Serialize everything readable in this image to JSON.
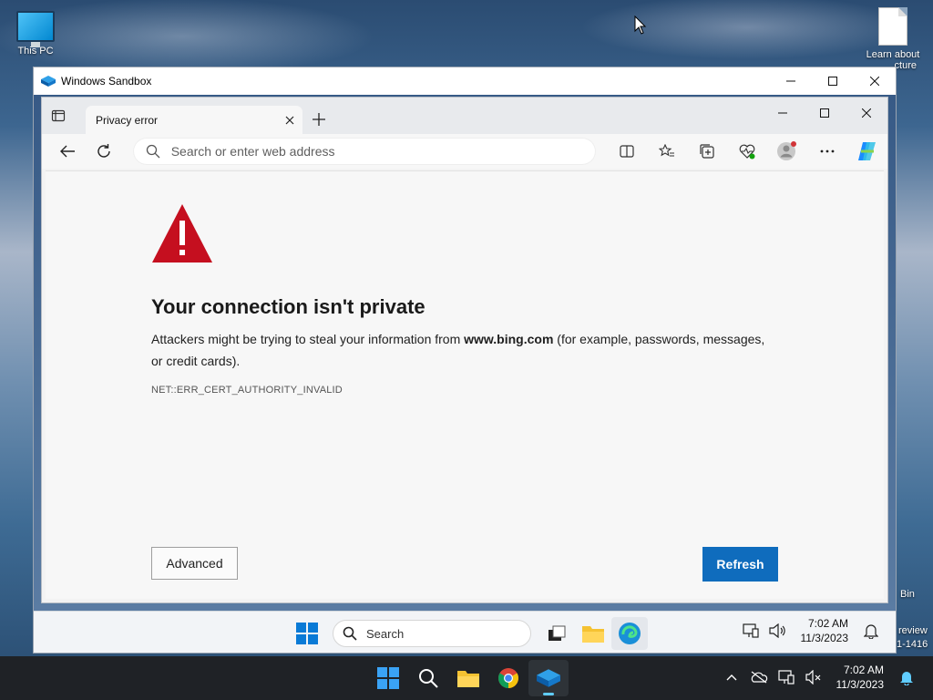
{
  "desktop": {
    "icons": [
      {
        "label": "This PC"
      },
      {
        "label": "Learn about",
        "label2": "cture"
      }
    ],
    "recycle_label": "Bin",
    "preview_label": "review",
    "build_label": "1-1416"
  },
  "sandbox": {
    "title": "Windows Sandbox"
  },
  "browser": {
    "tab_title": "Privacy error",
    "address_placeholder": "Search or enter web address",
    "page": {
      "heading": "Your connection isn't private",
      "desc_before": "Attackers might be trying to steal your information from ",
      "desc_domain": "www.bing.com",
      "desc_after": " (for example, passwords, messages, or credit cards).",
      "error_code": "NET::ERR_CERT_AUTHORITY_INVALID",
      "advanced_label": "Advanced",
      "refresh_label": "Refresh"
    }
  },
  "inner_taskbar": {
    "search_label": "Search",
    "time": "7:02 AM",
    "date": "11/3/2023"
  },
  "taskbar": {
    "time": "7:02 AM",
    "date": "11/3/2023"
  },
  "colors": {
    "accent": "#0f6cbd",
    "warning": "#c50f1f"
  }
}
